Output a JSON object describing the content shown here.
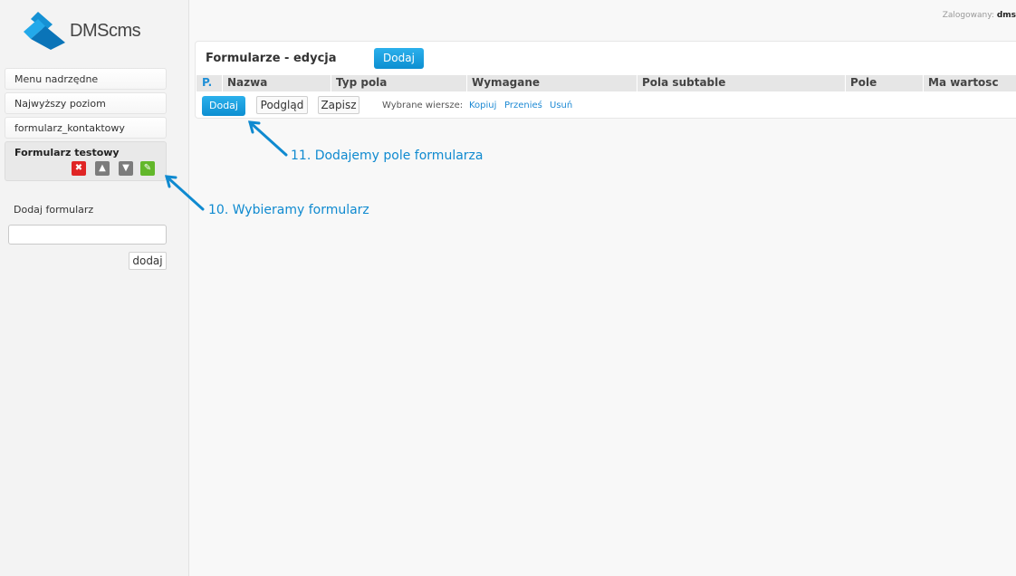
{
  "logo": {
    "text": "DMScms"
  },
  "header": {
    "logged_label": "Zalogowany:",
    "logged_user": "dms"
  },
  "sidebar": {
    "items": [
      {
        "label": "Menu nadrzędne"
      },
      {
        "label": "Najwyższy poziom"
      },
      {
        "label": "formularz_kontaktowy"
      }
    ],
    "active": {
      "label": "Formularz testowy",
      "actions": {
        "delete": "✖",
        "up": "▲",
        "down": "▼",
        "edit": "✎"
      }
    },
    "add_form": {
      "label": "Dodaj formularz",
      "input_value": "",
      "button": "dodaj"
    }
  },
  "panel": {
    "title": "Formularze - edycja",
    "add_button": "Dodaj",
    "columns": [
      "P.",
      "Nazwa",
      "Typ pola",
      "Wymagane",
      "Pola subtable",
      "Pole",
      "Ma wartosc"
    ],
    "row_actions": {
      "add": "Dodaj",
      "preview": "Podgląd",
      "save": "Zapisz",
      "selected_label": "Wybrane wiersze:",
      "copy": "Kopiuj",
      "move": "Przenieś",
      "delete": "Usuń"
    }
  },
  "annotations": {
    "step11": "11. Dodajemy pole formularza",
    "step10": "10. Wybieramy formularz"
  },
  "colors": {
    "accent": "#0d8fd1",
    "annotation": "#0f8ad0"
  }
}
